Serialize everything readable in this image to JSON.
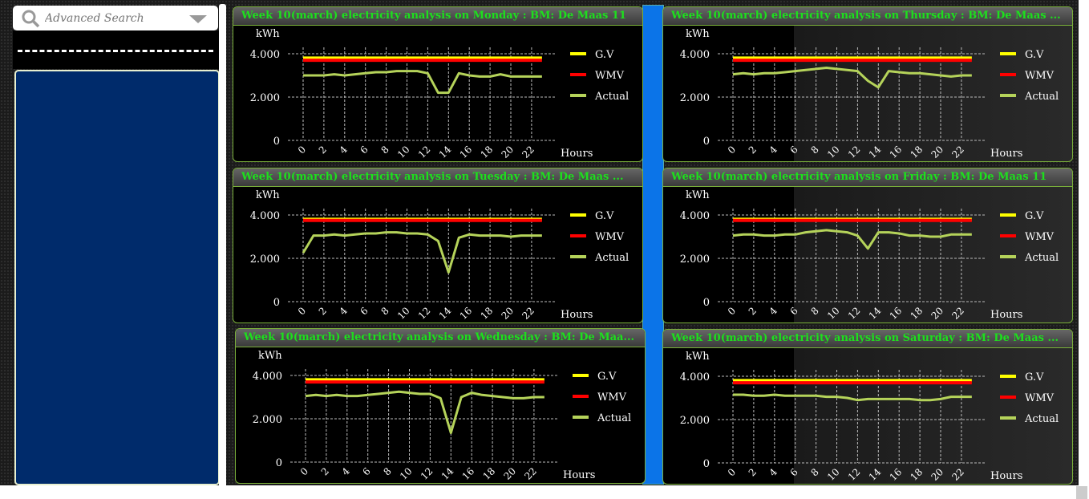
{
  "search": {
    "placeholder": "Advanced Search"
  },
  "colors": {
    "gv": "#ffff00",
    "wmv": "#ff0000",
    "actual": "#b5d35a",
    "title": "#1de01d",
    "accent": "#0b74e8"
  },
  "chart_data": [
    {
      "type": "line",
      "title": "Week 10(march) electricity analysis on Monday : BM: De Maas 11",
      "ylabel": "kWh",
      "xlabel": "Hours",
      "ylim": [
        0,
        4000
      ],
      "yticks": [
        "0",
        "2.000",
        "4.000"
      ],
      "xticks": [
        "0",
        "2",
        "4",
        "6",
        "8",
        "10",
        "12",
        "14",
        "16",
        "18",
        "20",
        "22"
      ],
      "legend": [
        "G.V",
        "WMV",
        "Actual"
      ],
      "series": [
        {
          "name": "G.V",
          "values": [
            3800,
            3800
          ]
        },
        {
          "name": "WMV",
          "values": [
            3700,
            3700
          ]
        },
        {
          "name": "Actual",
          "values": [
            3000,
            3000,
            3000,
            3050,
            3000,
            3050,
            3100,
            3150,
            3150,
            3200,
            3200,
            3200,
            3100,
            2200,
            2200,
            3100,
            3000,
            2950,
            2950,
            3050,
            2950,
            2950,
            2950,
            2950
          ]
        }
      ]
    },
    {
      "type": "line",
      "title": "Week 10(march) electricity analysis on Tuesday : BM: De Maas ...",
      "ylabel": "kWh",
      "xlabel": "Hours",
      "ylim": [
        0,
        4000
      ],
      "yticks": [
        "0",
        "2.000",
        "4.000"
      ],
      "xticks": [
        "0",
        "2",
        "4",
        "6",
        "8",
        "10",
        "12",
        "14",
        "16",
        "18",
        "20",
        "22"
      ],
      "legend": [
        "G.V",
        "WMV",
        "Actual"
      ],
      "series": [
        {
          "name": "G.V",
          "values": [
            3800,
            3800
          ]
        },
        {
          "name": "WMV",
          "values": [
            3750,
            3750
          ]
        },
        {
          "name": "Actual",
          "values": [
            2250,
            3050,
            3050,
            3100,
            3050,
            3100,
            3150,
            3150,
            3200,
            3200,
            3150,
            3150,
            3100,
            2800,
            1350,
            2950,
            3100,
            3050,
            3050,
            3050,
            3000,
            3050,
            3050,
            3050
          ]
        }
      ]
    },
    {
      "type": "line",
      "title": "Week 10(march) electricity analysis on Wednesday : BM: De Maa...",
      "ylabel": "kWh",
      "xlabel": "Hours",
      "ylim": [
        0,
        4000
      ],
      "yticks": [
        "0",
        "2.000",
        "4.000"
      ],
      "xticks": [
        "0",
        "2",
        "4",
        "6",
        "8",
        "10",
        "12",
        "14",
        "16",
        "18",
        "20",
        "22"
      ],
      "legend": [
        "G.V",
        "WMV",
        "Actual"
      ],
      "series": [
        {
          "name": "G.V",
          "values": [
            3800,
            3800
          ]
        },
        {
          "name": "WMV",
          "values": [
            3700,
            3700
          ]
        },
        {
          "name": "Actual",
          "values": [
            3050,
            3100,
            3050,
            3100,
            3050,
            3050,
            3100,
            3150,
            3200,
            3250,
            3200,
            3150,
            3150,
            2950,
            1350,
            3000,
            3200,
            3100,
            3050,
            3000,
            2950,
            2950,
            3000,
            3000
          ]
        }
      ]
    },
    {
      "type": "line",
      "title": "Week 10(march) electricity analysis on Thursday : BM: De Maas ...",
      "ylabel": "kWh",
      "xlabel": "Hours",
      "ylim": [
        0,
        4000
      ],
      "yticks": [
        "0",
        "2.000",
        "4.000"
      ],
      "xticks": [
        "0",
        "2",
        "4",
        "6",
        "8",
        "10",
        "12",
        "14",
        "16",
        "18",
        "20",
        "22"
      ],
      "legend": [
        "G.V",
        "WMV",
        "Actual"
      ],
      "series": [
        {
          "name": "G.V",
          "values": [
            3800,
            3800
          ]
        },
        {
          "name": "WMV",
          "values": [
            3700,
            3700
          ]
        },
        {
          "name": "Actual",
          "values": [
            3050,
            3100,
            3050,
            3100,
            3100,
            3150,
            3200,
            3250,
            3300,
            3350,
            3300,
            3250,
            3200,
            2750,
            2450,
            3200,
            3150,
            3100,
            3100,
            3050,
            3000,
            2950,
            3000,
            3000
          ]
        }
      ]
    },
    {
      "type": "line",
      "title": "Week 10(march) electricity analysis on Friday : BM: De Maas 11",
      "ylabel": "kWh",
      "xlabel": "Hours",
      "ylim": [
        0,
        4000
      ],
      "yticks": [
        "0",
        "2.000",
        "4.000"
      ],
      "xticks": [
        "0",
        "2",
        "4",
        "6",
        "8",
        "10",
        "12",
        "14",
        "16",
        "18",
        "20",
        "22"
      ],
      "legend": [
        "G.V",
        "WMV",
        "Actual"
      ],
      "series": [
        {
          "name": "G.V",
          "values": [
            3800,
            3800
          ]
        },
        {
          "name": "WMV",
          "values": [
            3750,
            3750
          ]
        },
        {
          "name": "Actual",
          "values": [
            3050,
            3100,
            3100,
            3050,
            3050,
            3100,
            3100,
            3200,
            3250,
            3300,
            3250,
            3200,
            3050,
            2450,
            3200,
            3200,
            3150,
            3050,
            3050,
            3000,
            3000,
            3100,
            3100,
            3100
          ]
        }
      ]
    },
    {
      "type": "line",
      "title": "Week 10(march) electricity analysis on Saturday : BM: De Maas ...",
      "ylabel": "kWh",
      "xlabel": "Hours",
      "ylim": [
        0,
        4000
      ],
      "yticks": [
        "0",
        "2.000",
        "4.000"
      ],
      "xticks": [
        "0",
        "2",
        "4",
        "6",
        "8",
        "10",
        "12",
        "14",
        "16",
        "18",
        "20",
        "22"
      ],
      "legend": [
        "G.V",
        "WMV",
        "Actual"
      ],
      "series": [
        {
          "name": "G.V",
          "values": [
            3800,
            3800
          ]
        },
        {
          "name": "WMV",
          "values": [
            3700,
            3700
          ]
        },
        {
          "name": "Actual",
          "values": [
            3150,
            3150,
            3100,
            3100,
            3150,
            3100,
            3100,
            3100,
            3100,
            3050,
            3050,
            3000,
            2900,
            2950,
            2950,
            2950,
            2950,
            2950,
            2900,
            2900,
            2950,
            3050,
            3050,
            3050
          ]
        }
      ]
    }
  ]
}
